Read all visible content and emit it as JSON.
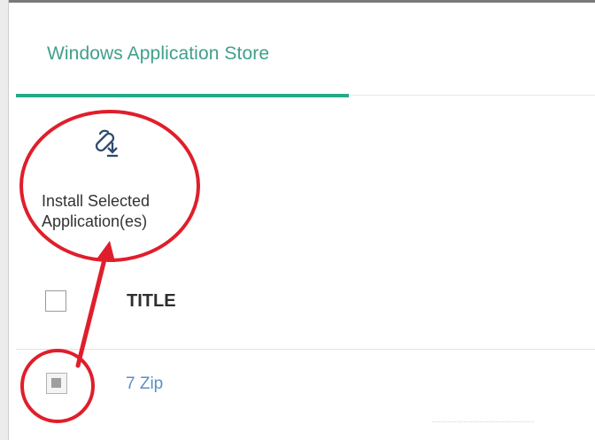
{
  "tabs": [
    {
      "label": "Windows Application Store",
      "active": true
    }
  ],
  "toolbar": {
    "install_selected": {
      "label": "Install Selected Application(es)",
      "icon": "install-apps-icon"
    }
  },
  "table": {
    "columns": [
      "TITLE"
    ],
    "rows": [
      {
        "title": "7 Zip",
        "selected": true
      }
    ]
  },
  "colors": {
    "accent": "#26a98a",
    "link": "#5b8fc7",
    "annotation": "#e01e2b"
  }
}
